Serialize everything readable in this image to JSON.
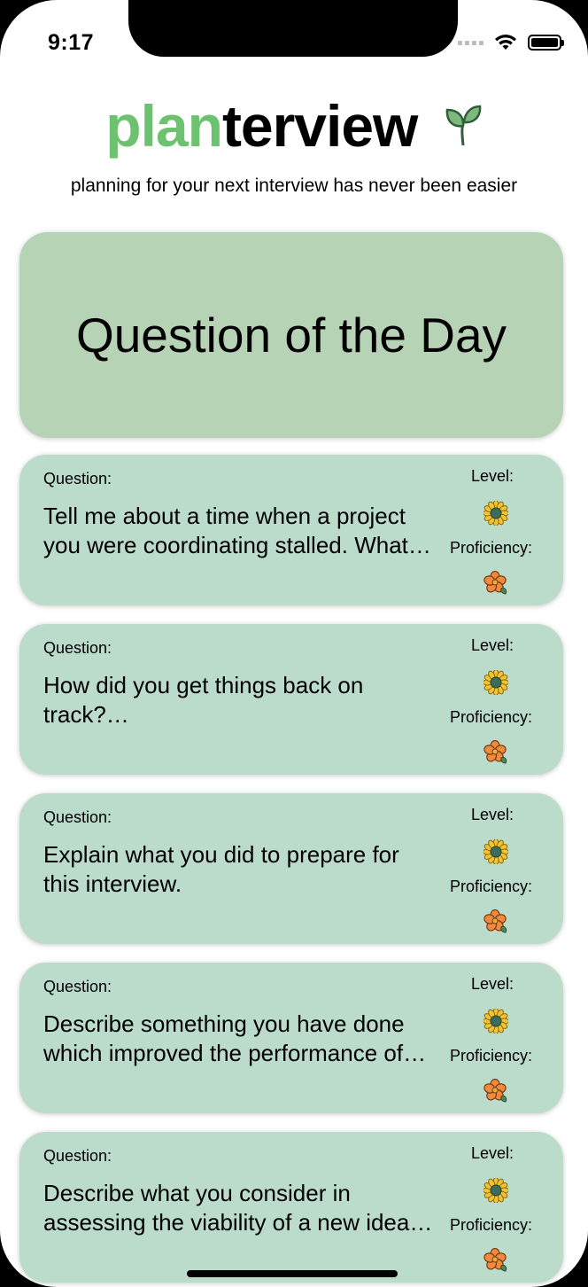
{
  "status_bar": {
    "time": "9:17"
  },
  "header": {
    "brand_part1": "plan",
    "brand_part2": "terview",
    "brand_icon": "sprout-icon",
    "tagline": "planning for your next interview has never been easier"
  },
  "question_of_the_day": {
    "title": "Question of the Day"
  },
  "cards": [
    {
      "question_label": "Question:",
      "question_text": "Tell me about a time when a project you were coordinating stalled. What…",
      "level_label": "Level:",
      "level_icon": "sunflower-icon",
      "proficiency_label": "Proficiency:",
      "proficiency_icon": "orange-flower-icon"
    },
    {
      "question_label": "Question:",
      "question_text": "How did you get things back on track?…",
      "level_label": "Level:",
      "level_icon": "sunflower-icon",
      "proficiency_label": "Proficiency:",
      "proficiency_icon": "orange-flower-icon"
    },
    {
      "question_label": "Question:",
      "question_text": "Explain what you did to prepare for this interview.",
      "level_label": "Level:",
      "level_icon": "sunflower-icon",
      "proficiency_label": "Proficiency:",
      "proficiency_icon": "orange-flower-icon"
    },
    {
      "question_label": "Question:",
      "question_text": "Describe something you have done which improved the performance of…",
      "level_label": "Level:",
      "level_icon": "sunflower-icon",
      "proficiency_label": "Proficiency:",
      "proficiency_icon": "orange-flower-icon"
    },
    {
      "question_label": "Question:",
      "question_text": "Describe what you consider in assessing the viability of a new idea…",
      "level_label": "Level:",
      "level_icon": "sunflower-icon",
      "proficiency_label": "Proficiency:",
      "proficiency_icon": "orange-flower-icon"
    }
  ],
  "colors": {
    "brand_green": "#6cc26f",
    "qod_background": "#b7d3b6",
    "card_background": "#bcdccb"
  }
}
